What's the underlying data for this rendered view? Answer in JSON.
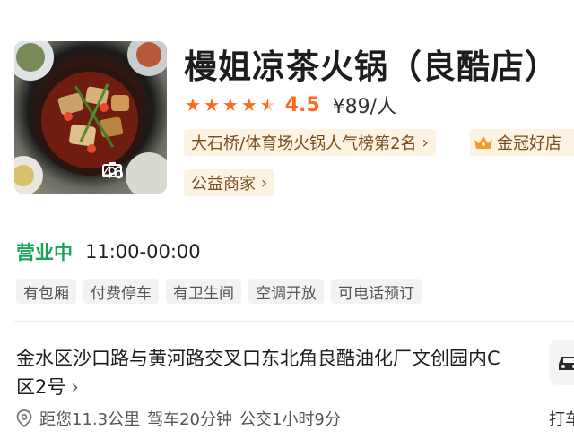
{
  "shop": {
    "title": "槾姐凉茶火锅（良酷店）",
    "photo_count": "46",
    "rating": 4.5,
    "score_label": "4.5",
    "price": "¥89/人",
    "rank_tag": "大石桥/体育场火锅人气榜第2名",
    "crown_tag": "金冠好店",
    "charity_tag": "公益商家"
  },
  "hours": {
    "status": "营业中",
    "time": "11:00-00:00"
  },
  "facilities": [
    "有包厢",
    "付费停车",
    "有卫生间",
    "空调开放",
    "可电话预订"
  ],
  "address": {
    "text": "金水区沙口路与黄河路交叉口东北角良酷油化厂文创园内C区2号",
    "distance": "距您11.3公里",
    "drive": "驾车20分钟",
    "transit": "公交1小时9分"
  },
  "taxi": {
    "label": "打车"
  },
  "colors": {
    "accent": "#ff6a1a",
    "open": "#19a25a",
    "tag_bg": "#fdf3e2",
    "tag_text": "#7b4c1b"
  }
}
